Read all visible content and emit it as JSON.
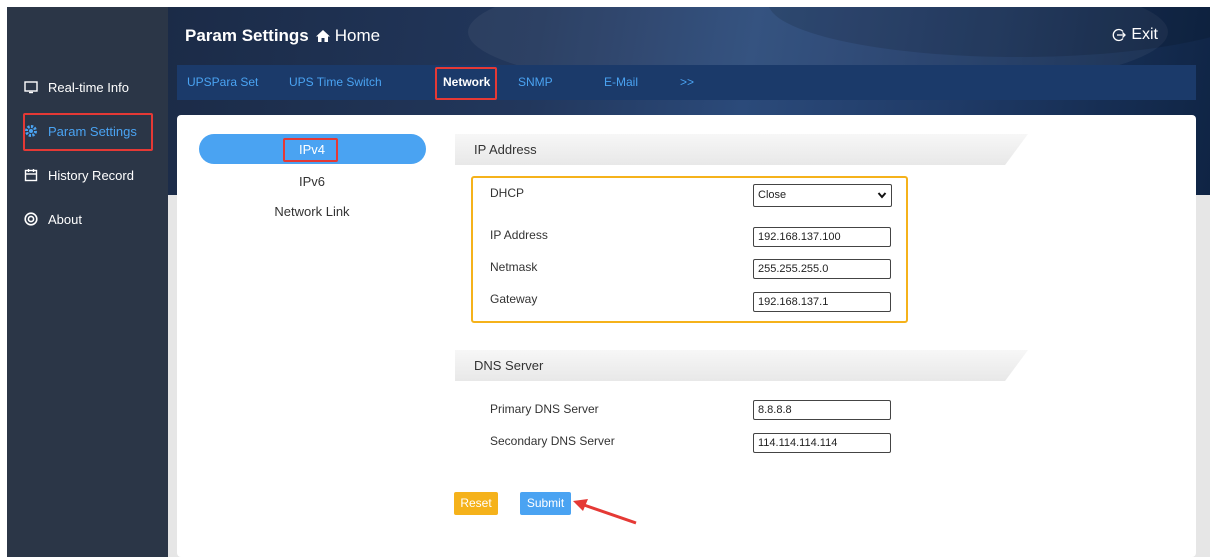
{
  "header": {
    "title": "Param Settings",
    "home_label": "Home",
    "exit_label": "Exit"
  },
  "sidebar": {
    "items": [
      {
        "label": "Real-time Info",
        "icon": "monitor-icon"
      },
      {
        "label": "Param Settings",
        "icon": "gear-icon"
      },
      {
        "label": "History Record",
        "icon": "calendar-icon"
      },
      {
        "label": "About",
        "icon": "info-circle-icon"
      }
    ],
    "active": "Param Settings"
  },
  "tabs": [
    {
      "label": "UPSPara Set"
    },
    {
      "label": "UPS Time Switch"
    },
    {
      "label": "Network"
    },
    {
      "label": "SNMP"
    },
    {
      "label": "E-Mail"
    },
    {
      "label": ">>"
    }
  ],
  "active_tab": "Network",
  "subnav": {
    "items": [
      {
        "label": "IPv4"
      },
      {
        "label": "IPv6"
      },
      {
        "label": "Network Link"
      }
    ],
    "active": "IPv4"
  },
  "ip_section": {
    "header": "IP Address",
    "dhcp": {
      "label": "DHCP",
      "value": "Close"
    },
    "ip_address": {
      "label": "IP Address",
      "value": "192.168.137.100"
    },
    "netmask": {
      "label": "Netmask",
      "value": "255.255.255.0"
    },
    "gateway": {
      "label": "Gateway",
      "value": "192.168.137.1"
    }
  },
  "dns_section": {
    "header": "DNS Server",
    "primary": {
      "label": "Primary DNS Server",
      "value": "8.8.8.8"
    },
    "secondary": {
      "label": "Secondary DNS Server",
      "value": "114.114.114.114"
    }
  },
  "buttons": {
    "reset": "Reset",
    "submit": "Submit"
  },
  "colors": {
    "sidebar_bg": "#2b3647",
    "accent_blue": "#4aa3f2",
    "highlight_red": "#e53935",
    "highlight_yellow": "#f5b21b",
    "reset_button": "#f5b21b",
    "submit_button": "#4aa3f2",
    "tabbar_bg": "#1b3a6a"
  }
}
